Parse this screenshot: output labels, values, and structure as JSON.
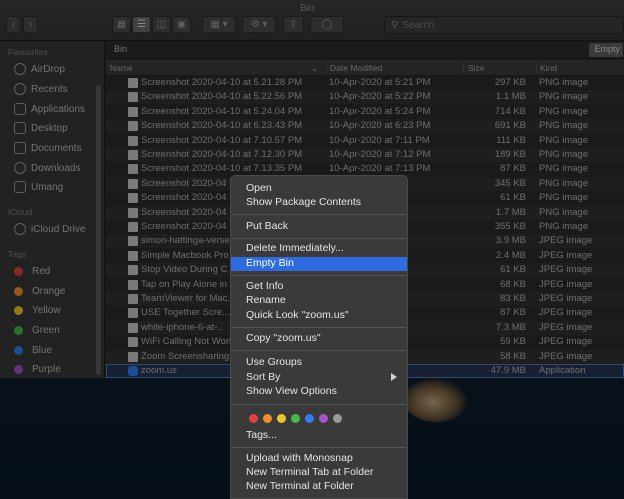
{
  "window": {
    "title": "Bin"
  },
  "toolbar": {
    "search_placeholder": "Search"
  },
  "sidebar": {
    "favourites_header": "Favourites",
    "favourites": [
      "AirDrop",
      "Recents",
      "Applications",
      "Desktop",
      "Documents",
      "Downloads",
      "Umang"
    ],
    "icloud_header": "iCloud",
    "icloud": [
      "iCloud Drive"
    ],
    "tags_header": "Tags",
    "tags": [
      {
        "label": "Red",
        "color": "#e0413a"
      },
      {
        "label": "Orange",
        "color": "#f0902c"
      },
      {
        "label": "Yellow",
        "color": "#e8c82f"
      },
      {
        "label": "Green",
        "color": "#48b94a"
      },
      {
        "label": "Blue",
        "color": "#2f7cf1"
      },
      {
        "label": "Purple",
        "color": "#a456c8"
      }
    ]
  },
  "path": {
    "location": "Bin",
    "empty_button": "Empty"
  },
  "columns": {
    "name": "Name",
    "date": "Date Modified",
    "size": "Size",
    "kind": "Kind"
  },
  "files": [
    {
      "name": "Screenshot 2020-04-10 at 5.21.28 PM",
      "date": "10-Apr-2020 at 5:21 PM",
      "size": "297 KB",
      "kind": "PNG image"
    },
    {
      "name": "Screenshot 2020-04-10 at 5.22.56 PM",
      "date": "10-Apr-2020 at 5:22 PM",
      "size": "1.1 MB",
      "kind": "PNG image"
    },
    {
      "name": "Screenshot 2020-04-10 at 5.24.04 PM",
      "date": "10-Apr-2020 at 5:24 PM",
      "size": "714 KB",
      "kind": "PNG image"
    },
    {
      "name": "Screenshot 2020-04-10 at 6.23.43 PM",
      "date": "10-Apr-2020 at 6:23 PM",
      "size": "691 KB",
      "kind": "PNG image"
    },
    {
      "name": "Screenshot 2020-04-10 at 7.10.57 PM",
      "date": "10-Apr-2020 at 7:11 PM",
      "size": "111 KB",
      "kind": "PNG image"
    },
    {
      "name": "Screenshot 2020-04-10 at 7.12.30 PM",
      "date": "10-Apr-2020 at 7:12 PM",
      "size": "189 KB",
      "kind": "PNG image"
    },
    {
      "name": "Screenshot 2020-04-10 at 7.13.35 PM",
      "date": "10-Apr-2020 at 7:13 PM",
      "size": "87 KB",
      "kind": "PNG image"
    },
    {
      "name": "Screenshot 2020-04",
      "date": "18 PM",
      "size": "345 KB",
      "kind": "PNG image"
    },
    {
      "name": "Screenshot 2020-04",
      "date": "19 PM",
      "size": "61 KB",
      "kind": "PNG image"
    },
    {
      "name": "Screenshot 2020-04",
      "date": "17 PM",
      "size": "1.7 MB",
      "kind": "PNG image"
    },
    {
      "name": "Screenshot 2020-04",
      "date": "19 PM",
      "size": "355 KB",
      "kind": "PNG image"
    },
    {
      "name": "simon-hattinga-verse",
      "date": "5 PM",
      "size": "3.9 MB",
      "kind": "JPEG image"
    },
    {
      "name": "Simple Macbook Pro",
      "date": "24 PM",
      "size": "2.4 MB",
      "kind": "JPEG image"
    },
    {
      "name": "Stop Video During C",
      "date": "22 PM",
      "size": "61 KB",
      "kind": "JPEG image"
    },
    {
      "name": "Tap on Play Alone in",
      "date": "21 PM",
      "size": "68 KB",
      "kind": "JPEG image"
    },
    {
      "name": "TeamViewer for Mac.",
      "date": "24 PM",
      "size": "83 KB",
      "kind": "JPEG image"
    },
    {
      "name": "USE Together Scre...",
      "date": "22 PM",
      "size": "87 KB",
      "kind": "JPEG image"
    },
    {
      "name": "white-iphone-6-at-..",
      "date": "19 PM",
      "size": "7.3 MB",
      "kind": "JPEG image"
    },
    {
      "name": "WiFi Calling Not Work",
      "date": "05 AM",
      "size": "59 KB",
      "kind": "JPEG image"
    },
    {
      "name": "Zoom Screensharing",
      "date": "05 PM",
      "size": "58 KB",
      "kind": "JPEG image"
    },
    {
      "name": "zoom.us",
      "date": "PM",
      "size": "47.9 MB",
      "kind": "Application"
    }
  ],
  "context_menu": {
    "open": "Open",
    "show_package": "Show Package Contents",
    "put_back": "Put Back",
    "delete_immediately": "Delete Immediately...",
    "empty_bin": "Empty Bin",
    "get_info": "Get Info",
    "rename": "Rename",
    "quick_look": "Quick Look \"zoom.us\"",
    "copy": "Copy \"zoom.us\"",
    "use_groups": "Use Groups",
    "sort_by": "Sort By",
    "show_view_options": "Show View Options",
    "tags": "Tags...",
    "upload_monosnap": "Upload with Monosnap",
    "new_terminal_tab": "New Terminal Tab at Folder",
    "new_terminal": "New Terminal at Folder",
    "tag_colors": [
      "#e0413a",
      "#f0902c",
      "#e8c82f",
      "#48b94a",
      "#2f7cf1",
      "#a456c8",
      "#9a9a9a"
    ]
  }
}
